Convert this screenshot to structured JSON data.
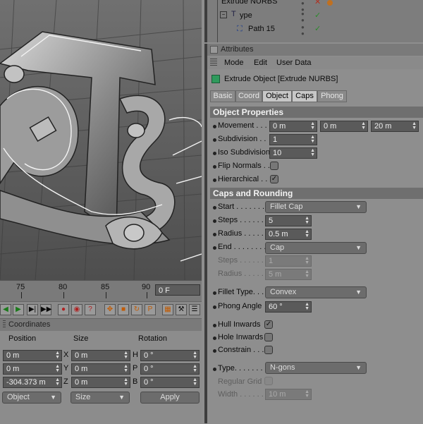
{
  "object_manager": {
    "rows": [
      {
        "label": "Extrude NURBS"
      },
      {
        "label": "ype"
      },
      {
        "label": "Path 15"
      }
    ]
  },
  "attributes": {
    "panel_title": "Attributes",
    "menu": [
      "Mode",
      "Edit",
      "User Data"
    ],
    "object_title": "Extrude Object [Extrude NURBS]",
    "tabs": [
      {
        "label": "Basic",
        "active": false
      },
      {
        "label": "Coord",
        "active": false
      },
      {
        "label": "Object",
        "active": true
      },
      {
        "label": "Caps",
        "active": true
      },
      {
        "label": "Phong",
        "active": false
      }
    ],
    "object_properties": {
      "header": "Object Properties",
      "movement_label": "Movement . . .",
      "movement": [
        "0 m",
        "0 m",
        "20 m"
      ],
      "subdivision_label": "Subdivision . .",
      "subdivision": "1",
      "iso_label": "Iso Subdivision",
      "iso": "10",
      "flip_label": "Flip Normals . .",
      "flip_checked": false,
      "hier_label": "Hierarchical . .",
      "hier_checked": true
    },
    "caps": {
      "header": "Caps and Rounding",
      "start_label": "Start . . . . . . .",
      "start": "Fillet Cap",
      "steps_label": "Steps . . . . . .",
      "steps": "5",
      "radius_label": "Radius . . . . .",
      "radius": "0.5 m",
      "end_label": "End . . . . . . . .",
      "end": "Cap",
      "steps2_label": "Steps . . . . . .",
      "steps2": "1",
      "radius2_label": "Radius . . . . .",
      "radius2": "5 m",
      "fillet_type_label": "Fillet Type. . . .",
      "fillet_type": "Convex",
      "phong_label": "Phong Angle",
      "phong": "60 °",
      "hull_label": "Hull Inwards",
      "hull_checked": true,
      "hole_label": "Hole Inwards",
      "hole_checked": false,
      "constrain_label": "Constrain . . .",
      "constrain_checked": false,
      "type_label": "Type. . . . . . . .",
      "type": "N-gons",
      "regular_label": "Regular Grid",
      "regular_checked": false,
      "width_label": "Width . . . . . .",
      "width": "10 m"
    }
  },
  "timeline": {
    "ticks": [
      "75",
      "80",
      "85",
      "90"
    ],
    "frame": "0 F"
  },
  "coordinates": {
    "title": "Coordinates",
    "col_position": "Position",
    "col_size": "Size",
    "col_rotation": "Rotation",
    "rows": [
      {
        "pos": "0 m",
        "axis": "X",
        "size": "0 m",
        "rot_axis": "H",
        "rot": "0 °"
      },
      {
        "pos": "0 m",
        "axis": "Y",
        "size": "0 m",
        "rot_axis": "P",
        "rot": "0 °"
      },
      {
        "pos": "-304.373 m",
        "axis": "Z",
        "size": "0 m",
        "rot_axis": "B",
        "rot": "0 °"
      }
    ],
    "mode_select": "Object",
    "size_select": "Size",
    "apply_label": "Apply"
  }
}
